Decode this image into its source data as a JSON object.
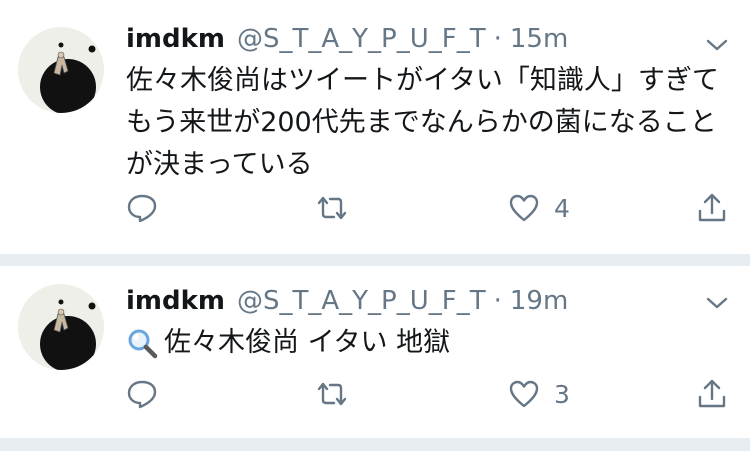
{
  "tweets": [
    {
      "name": "imdkm",
      "handle": "@S_T_A_Y_P_U_F_T",
      "separator": "·",
      "time": "15m",
      "text": "佐々木俊尚はツイートがイタい「知識人」すぎてもう来世が200代先までなんらかの菌になることが決まっている",
      "likes": "4",
      "avatar_icon": "avatar-figure-on-black-circle",
      "reply_icon": "reply-icon",
      "retweet_icon": "retweet-icon",
      "like_icon": "heart-icon",
      "share_icon": "share-icon",
      "menu_icon": "chevron-down-icon"
    },
    {
      "name": "imdkm",
      "handle": "@S_T_A_Y_P_U_F_T",
      "separator": "·",
      "time": "19m",
      "text_icon": "search-icon",
      "text": "佐々木俊尚 イタい 地獄",
      "likes": "3",
      "avatar_icon": "avatar-figure-on-black-circle",
      "reply_icon": "reply-icon",
      "retweet_icon": "retweet-icon",
      "like_icon": "heart-icon",
      "share_icon": "share-icon",
      "menu_icon": "chevron-down-icon"
    }
  ],
  "colors": {
    "text": "#14171a",
    "secondary": "#657786",
    "divider": "#e6ecf0",
    "search_icon": "#6aa6dc"
  }
}
